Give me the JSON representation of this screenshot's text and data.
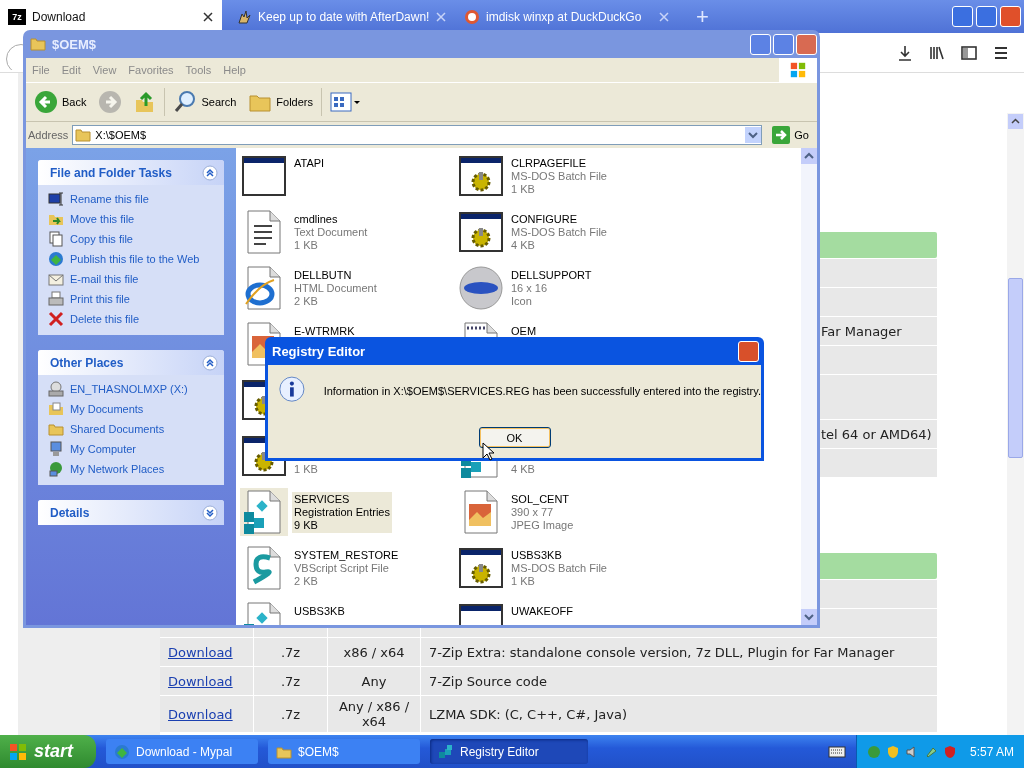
{
  "browser": {
    "tabs": [
      {
        "title": "Download",
        "selected": true,
        "kind": "sevenzip",
        "icon_text": "7z"
      },
      {
        "title": "Keep up to date with AfterDawn!",
        "selected": false,
        "kind": "afterdawn"
      },
      {
        "title": "imdisk winxp at DuckDuckGo",
        "selected": false,
        "kind": "duck"
      }
    ],
    "new_tab": "+"
  },
  "page": {
    "table_top": {
      "rows": [
        {},
        {},
        {
          "description": "Far Manager"
        },
        {},
        {},
        {
          "description": "tel 64 or AMD64)"
        },
        {}
      ]
    },
    "table_bottom": {
      "rows": [
        {},
        {},
        {
          "link": "Download",
          "format": ".7z",
          "arch": "x86 / x64",
          "description": "7-Zip Extra: standalone console version, 7z DLL, Plugin for Far Manager"
        },
        {
          "link": "Download",
          "format": ".7z",
          "arch": "Any",
          "description": "7-Zip Source code"
        },
        {
          "link": "Download",
          "format": ".7z",
          "arch": "Any / x86 / x64",
          "description": "LZMA SDK: (C, C++, C#, Java)"
        }
      ]
    }
  },
  "explorer": {
    "title": "$OEM$",
    "menu": [
      "File",
      "Edit",
      "View",
      "Favorites",
      "Tools",
      "Help"
    ],
    "toolbar": [
      {
        "kind": "back",
        "label": "Back",
        "disabled": false
      },
      {
        "kind": "forward",
        "disabled": true
      },
      {
        "kind": "up",
        "disabled": false
      },
      {
        "kind": "search",
        "label": "Search",
        "disabled": false
      },
      {
        "kind": "folders",
        "label": "Folders",
        "disabled": false
      },
      {
        "kind": "views",
        "disabled": false
      }
    ],
    "address": {
      "label": "Address",
      "value": "X:\\$OEM$",
      "go": "Go"
    },
    "sections": [
      {
        "title": "File and Folder Tasks",
        "expanded": true,
        "items": [
          {
            "kind": "rename",
            "label": "Rename this file"
          },
          {
            "kind": "move",
            "label": "Move this file"
          },
          {
            "kind": "copy",
            "label": "Copy this file"
          },
          {
            "kind": "publish",
            "label": "Publish this file to the Web"
          },
          {
            "kind": "email",
            "label": "E-mail this file"
          },
          {
            "kind": "print",
            "label": "Print this file"
          },
          {
            "kind": "delete",
            "label": "Delete this file"
          }
        ]
      },
      {
        "title": "Other Places",
        "expanded": true,
        "items": [
          {
            "kind": "drive",
            "label": "EN_THASNOLMXP (X:)"
          },
          {
            "kind": "documents",
            "label": "My Documents"
          },
          {
            "kind": "folder",
            "label": "Shared Documents"
          },
          {
            "kind": "computer",
            "label": "My Computer"
          },
          {
            "kind": "network",
            "label": "My Network Places"
          }
        ]
      },
      {
        "title": "Details",
        "expanded": false
      }
    ],
    "file_rows": [
      [
        {
          "kind": "window",
          "name": "ATAPI",
          "selected": false
        },
        {
          "kind": "batch",
          "name": "CLRPAGEFILE",
          "type": "MS-DOS Batch File",
          "size": "1 KB",
          "selected": false
        }
      ],
      [
        {
          "kind": "text",
          "name": "cmdlines",
          "type": "Text Document",
          "size": "1 KB",
          "selected": false
        },
        {
          "kind": "batch",
          "name": "CONFIGURE",
          "type": "MS-DOS Batch File",
          "size": "4 KB",
          "selected": false
        }
      ],
      [
        {
          "kind": "web",
          "name": "DELLBUTN",
          "type": "HTML Document",
          "size": "2 KB",
          "selected": false
        },
        {
          "kind": "sphere",
          "name": "DELLSUPPORT",
          "type": "16 x 16",
          "size": "Icon",
          "selected": false
        }
      ],
      [
        {
          "kind": "image",
          "name": "E-WTRMRK",
          "selected": false
        },
        {
          "kind": "notepad",
          "name": "OEM",
          "selected": false
        }
      ],
      [
        {
          "kind": "batch"
        }
      ],
      [
        {
          "kind": "batch",
          "size": "1 KB",
          "selected": false
        },
        {
          "kind": "registry",
          "size": "4 KB",
          "selected": false
        }
      ],
      [
        {
          "kind": "registry",
          "name": "SERVICES",
          "type": "Registration Entries",
          "size": "9 KB",
          "selected": true
        },
        {
          "kind": "image",
          "name": "SOL_CENT",
          "type": "390 x 77",
          "size": "JPEG Image",
          "selected": false
        }
      ],
      [
        {
          "kind": "script",
          "name": "SYSTEM_RESTORE",
          "type": "VBScript Script File",
          "size": "2 KB",
          "selected": false
        },
        {
          "kind": "batch",
          "name": "USBS3KB",
          "type": "MS-DOS Batch File",
          "size": "1 KB",
          "selected": false
        }
      ],
      [
        {
          "kind": "registry",
          "name": "USBS3KB",
          "selected": false
        },
        {
          "kind": "window",
          "name": "UWAKEOFF",
          "selected": false
        }
      ]
    ]
  },
  "dialog": {
    "title": "Registry Editor",
    "message": "Information in X:\\$OEM$\\SERVICES.REG has been successfully entered into the registry.",
    "button": "OK"
  },
  "taskbar": {
    "start": "start",
    "tasks": [
      {
        "kind": "browser",
        "label": "Download - Mypal",
        "selected": false
      },
      {
        "kind": "folder",
        "label": "$OEM$",
        "selected": false
      },
      {
        "kind": "registry",
        "label": "Registry Editor",
        "selected": true
      }
    ],
    "clock": "5:57 AM"
  }
}
